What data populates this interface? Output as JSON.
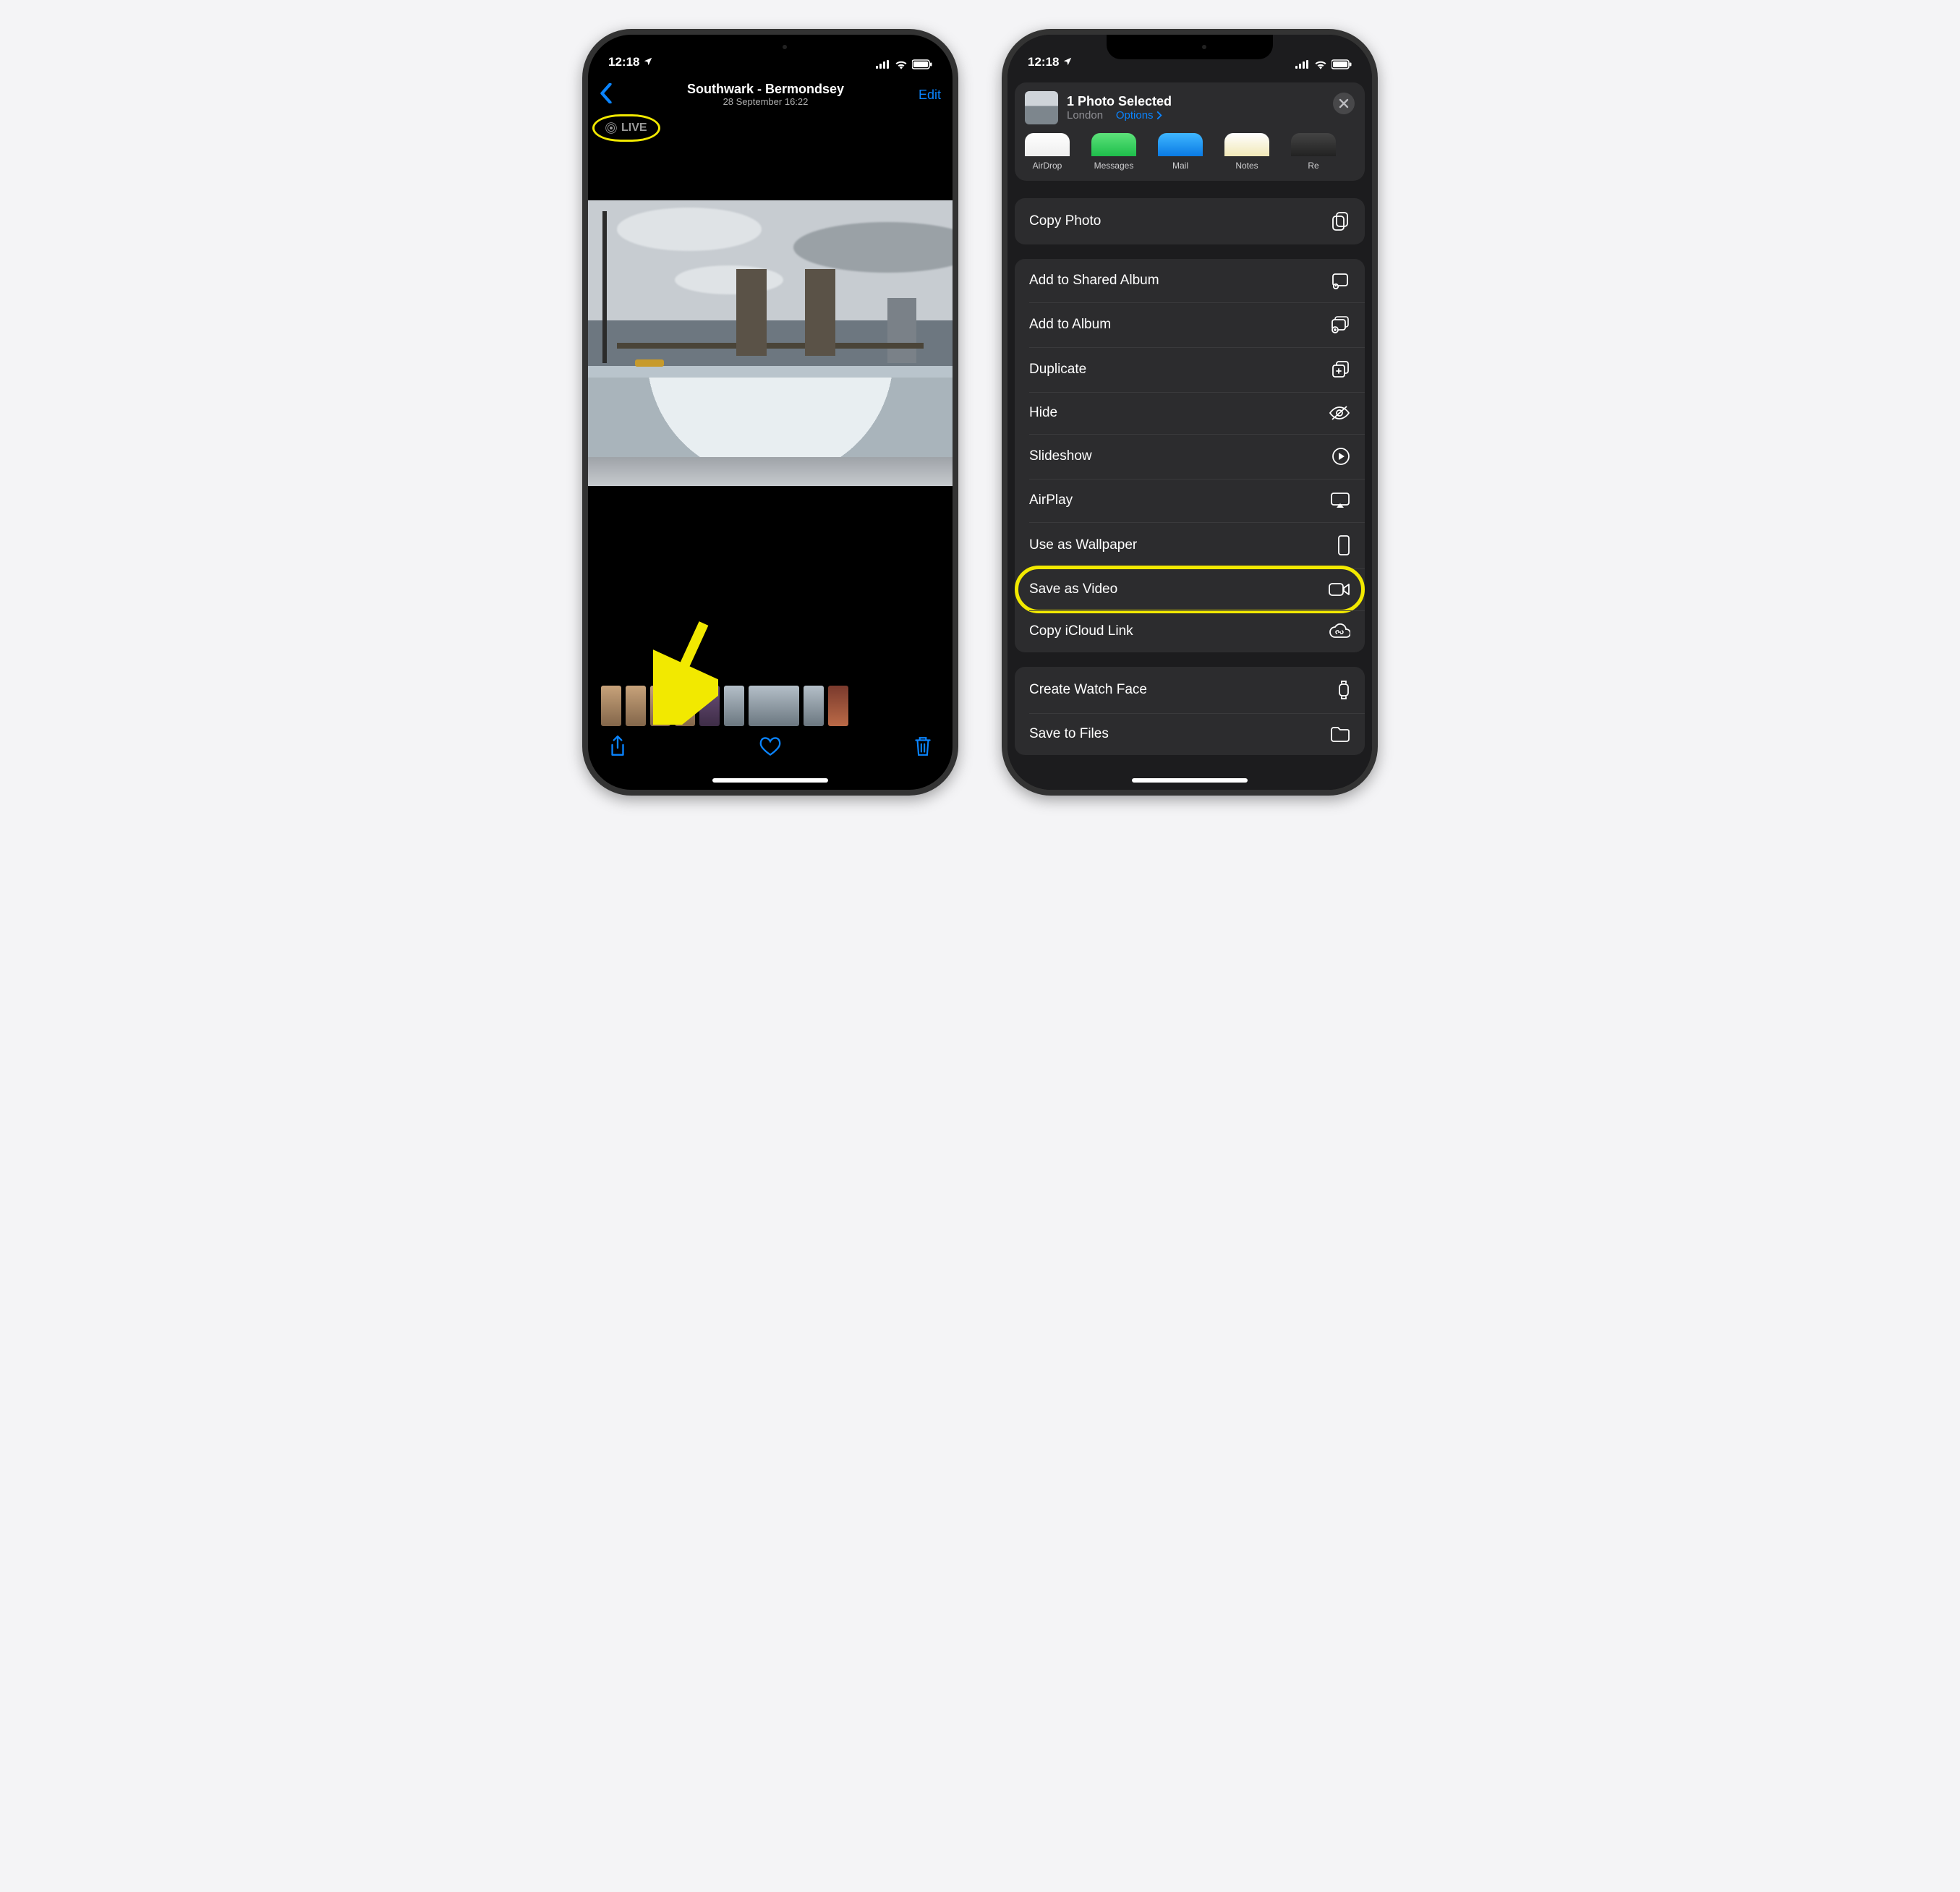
{
  "status": {
    "time": "12:18"
  },
  "left": {
    "title": "Southwark - Bermondsey",
    "subtitle": "28 September  16:22",
    "edit": "Edit",
    "live_badge": "LIVE"
  },
  "right": {
    "header_title": "1 Photo Selected",
    "header_location": "London",
    "header_options": "Options",
    "apps": {
      "airdrop": "AirDrop",
      "messages": "Messages",
      "mail": "Mail",
      "notes": "Notes",
      "re": "Re"
    },
    "actions": {
      "copy_photo": "Copy Photo",
      "add_shared_album": "Add to Shared Album",
      "add_album": "Add to Album",
      "duplicate": "Duplicate",
      "hide": "Hide",
      "slideshow": "Slideshow",
      "airplay": "AirPlay",
      "wallpaper": "Use as Wallpaper",
      "save_as_video": "Save as Video",
      "copy_icloud": "Copy iCloud Link",
      "watch_face": "Create Watch Face",
      "save_files": "Save to Files"
    }
  }
}
